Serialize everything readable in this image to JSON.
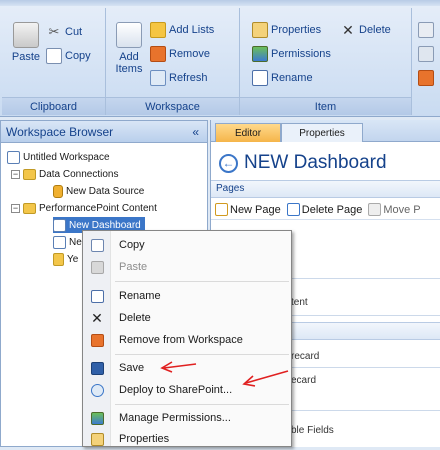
{
  "ribbon": {
    "groups": {
      "clipboard": {
        "label": "Clipboard",
        "paste": "Paste",
        "cut": "Cut",
        "copy": "Copy"
      },
      "workspace": {
        "label": "Workspace",
        "add_items": "Add Items",
        "add_lists": "Add Lists",
        "remove": "Remove",
        "refresh": "Refresh"
      },
      "item": {
        "label": "Item",
        "properties": "Properties",
        "delete": "Delete",
        "permissions": "Permissions",
        "rename": "Rename"
      }
    }
  },
  "browser": {
    "title": "Workspace Browser",
    "collapse": "«",
    "tree": [
      {
        "label": "Untitled Workspace"
      },
      {
        "label": "Data Connections"
      },
      {
        "label": "New Data Source"
      },
      {
        "label": "PerformancePoint Content"
      },
      {
        "label": "New Dashboard"
      },
      {
        "label": "Ne"
      },
      {
        "label": "Ye"
      }
    ]
  },
  "editor": {
    "tabs": [
      "Editor",
      "Properties"
    ],
    "title": "NEW Dashboard",
    "pages_label": "Pages",
    "new_page": "New Page",
    "delete_page": "Delete Page",
    "move": "Move P",
    "ghost_labels": [
      "tent",
      "recard",
      "ecard",
      "ble Fields"
    ]
  },
  "context_menu": {
    "items": [
      {
        "label": "Copy",
        "icon": "copy-icon",
        "disabled": false
      },
      {
        "label": "Paste",
        "icon": "paste-icon",
        "disabled": true
      },
      {
        "label": "Rename",
        "icon": "rename-icon",
        "disabled": false
      },
      {
        "label": "Delete",
        "icon": "delete-icon",
        "disabled": false
      },
      {
        "label": "Remove from Workspace",
        "icon": "remove-icon",
        "disabled": false
      },
      {
        "label": "Save",
        "icon": "save-icon",
        "disabled": false
      },
      {
        "label": "Deploy to SharePoint...",
        "icon": "deploy-icon",
        "disabled": false
      },
      {
        "label": "Manage Permissions...",
        "icon": "permissions-icon",
        "disabled": false
      },
      {
        "label": "Properties",
        "icon": "properties-icon",
        "disabled": false
      }
    ]
  },
  "colors": {
    "accent": "#15428b",
    "selection": "#3b76c8",
    "annotation_arrow": "#e02020"
  }
}
